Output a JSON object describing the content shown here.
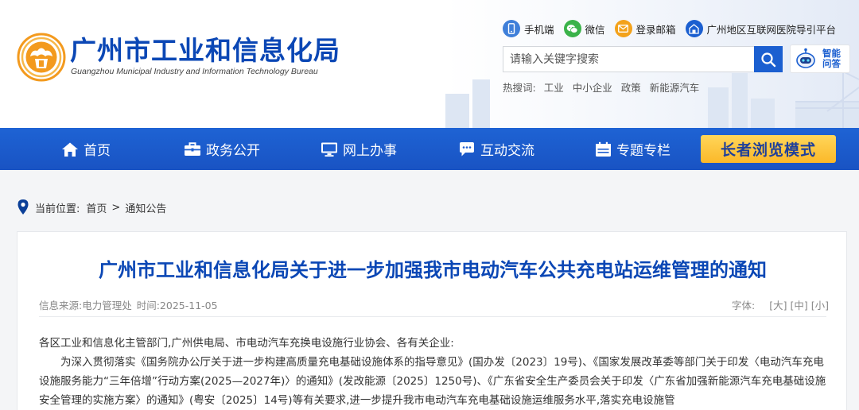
{
  "header": {
    "title": "广州市工业和信息化局",
    "subtitle": "Guangzhou Municipal Industry and Information Technology Bureau",
    "quick_links": [
      {
        "label": "手机端",
        "icon": "mobile-icon",
        "color": "#3f7fd9"
      },
      {
        "label": "微信",
        "icon": "wechat-icon",
        "color": "#3bb34a"
      },
      {
        "label": "登录邮箱",
        "icon": "mail-icon",
        "color": "#f3a21b"
      },
      {
        "label": "广州地区互联网医院导引平台",
        "icon": "hospital-icon",
        "color": "#1b5fd0"
      }
    ],
    "search": {
      "placeholder": "请输入关键字搜索"
    },
    "ai_assistant": {
      "line1": "智能",
      "line2": "问答"
    },
    "hot_search": {
      "label": "热搜词:",
      "items": [
        "工业",
        "中小企业",
        "政策",
        "新能源汽车"
      ]
    }
  },
  "nav": {
    "items": [
      {
        "label": "首页",
        "icon": "home-icon"
      },
      {
        "label": "政务公开",
        "icon": "briefcase-icon"
      },
      {
        "label": "网上办事",
        "icon": "monitor-icon"
      },
      {
        "label": "互动交流",
        "icon": "chat-icon"
      },
      {
        "label": "专题专栏",
        "icon": "calendar-icon"
      }
    ],
    "elder_mode": "长者浏览模式"
  },
  "breadcrumb": {
    "label": "当前位置:",
    "home": "首页",
    "separator": ">",
    "current": "通知公告"
  },
  "article": {
    "title": "广州市工业和信息化局关于进一步加强我市电动汽车公共充电站运维管理的通知",
    "source": "信息来源:电力管理处",
    "time": "时间:2025-11-05",
    "font_size": {
      "label": "字体:",
      "large": "[大]",
      "medium": "[中]",
      "small": "[小]"
    },
    "paragraphs": [
      "各区工业和信息化主管部门,广州供电局、市电动汽车充换电设施行业协会、各有关企业:",
      "为深入贯彻落实《国务院办公厅关于进一步构建高质量充电基础设施体系的指导意见》(国办发〔2023〕19号)、《国家发展改革委等部门关于印发〈电动汽车充电设施服务能力“三年倍增”行动方案(2025—2027年)〉的通知》(发改能源〔2025〕1250号)、《广东省安全生产委员会关于印发〈广东省加强新能源汽车充电基础设施安全管理的实施方案〉的通知》(粤安〔2025〕14号)等有关要求,进一步提升我市电动汽车充电基础设施运维服务水平,落实充电设施管"
    ]
  },
  "colors": {
    "brand_blue": "#0b47b5",
    "nav_blue": "#1e63d4",
    "elder_yellow": "#fbb829",
    "logo_orange": "#f39a1e"
  }
}
